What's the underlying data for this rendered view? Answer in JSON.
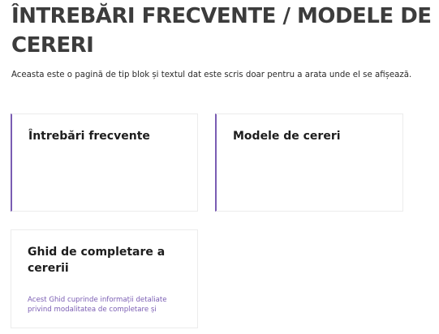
{
  "page": {
    "title": "ÎNTREBĂRI FRECVENTE / MODELE DE CERERI",
    "intro": "Aceasta este o pagină de tip blok și textul dat este scris doar pentru a arata unde el se afișează."
  },
  "cards": [
    {
      "title": "Întrebări frecvente",
      "description": ""
    },
    {
      "title": "Modele de cereri",
      "description": ""
    },
    {
      "title": "Ghid de completare a cererii",
      "description": "Acest Ghid cuprinde informații detaliate privind modalitatea de completare și"
    }
  ],
  "colors": {
    "accent": "#7a5db3",
    "title": "#3c3c3c",
    "text": "#2a2a2a",
    "card_border": "#ececec"
  }
}
